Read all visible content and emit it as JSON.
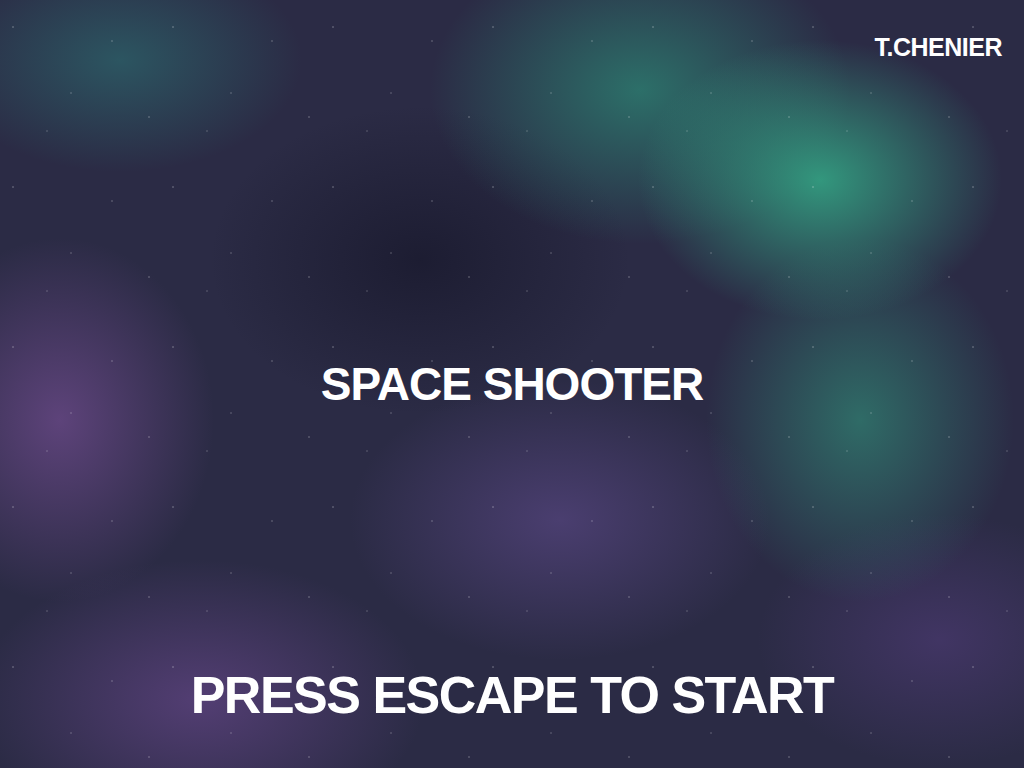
{
  "author": "T.CHENIER",
  "title": "SPACE SHOOTER",
  "prompt": "PRESS ESCAPE TO START"
}
